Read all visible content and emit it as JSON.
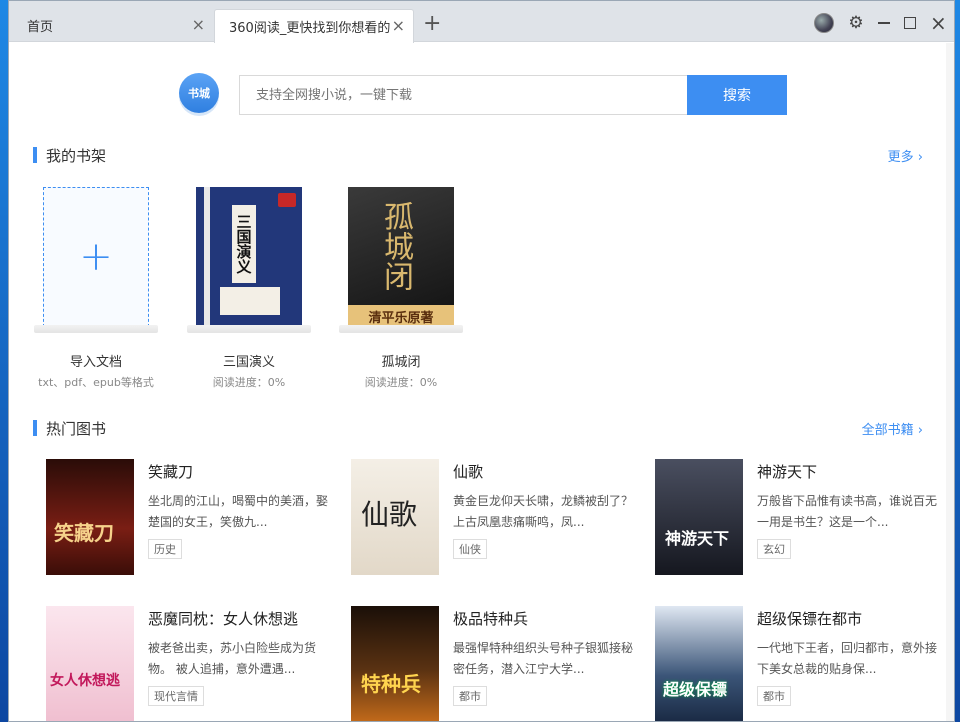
{
  "tabs": [
    {
      "label": "首页",
      "active": false
    },
    {
      "label": "360阅读_更快找到你想看的",
      "active": true
    }
  ],
  "icons": {
    "new_tab": "+",
    "close": "×",
    "gear": "⚙"
  },
  "logo": {
    "text": "书城"
  },
  "search": {
    "placeholder": "支持全网搜小说，一键下载",
    "button": "搜索"
  },
  "shelf": {
    "title": "我的书架",
    "more": "更多 ›",
    "items": [
      {
        "name": "导入文档",
        "sub": "txt、pdf、epub等格式"
      },
      {
        "name": "三国演义",
        "sub": "阅读进度：0%"
      },
      {
        "name": "孤城闭",
        "sub": "阅读进度：0%"
      }
    ]
  },
  "hot": {
    "title": "热门图书",
    "more": "全部书籍 ›",
    "books": [
      {
        "title": "笑藏刀",
        "desc": "坐北周的江山，喝蜀中的美酒，娶楚国的女王，笑傲九...",
        "tag": "历史",
        "cover_text": "笑藏刀",
        "cover_color": "#7a1e14"
      },
      {
        "title": "仙歌",
        "desc": "黄金巨龙仰天长啸，龙鳞被刮了？ 上古凤凰悲痛嘶鸣，凤...",
        "tag": "仙侠",
        "cover_text": "仙歌",
        "cover_color": "#e9e2d6"
      },
      {
        "title": "神游天下",
        "desc": "万般皆下品惟有读书高，谁说百无一用是书生？这是一个...",
        "tag": "玄幻",
        "cover_text": "神游天下",
        "cover_color": "#2a2d3a"
      },
      {
        "title": "恶魔同枕：女人休想逃",
        "desc": "被老爸出卖，苏小白险些成为货物。 被人追捕，意外遭遇...",
        "tag": "现代言情",
        "cover_text": "女人休想逃",
        "cover_color": "#f6d6e2"
      },
      {
        "title": "极品特种兵",
        "desc": "最强悍特种组织头号种子银狐接秘密任务，潜入江宁大学...",
        "tag": "都市",
        "cover_text": "特种兵",
        "cover_color": "#3a2410"
      },
      {
        "title": "超级保镖在都市",
        "desc": "一代地下王者，回归都市，意外接下美女总裁的贴身保...",
        "tag": "都市",
        "cover_text": "超级保镖",
        "cover_color": "#1f3250"
      }
    ]
  },
  "covers": {
    "sanguo": "三国演义",
    "gucheng": "孤城闭",
    "gucheng_band": "清平乐原著"
  }
}
